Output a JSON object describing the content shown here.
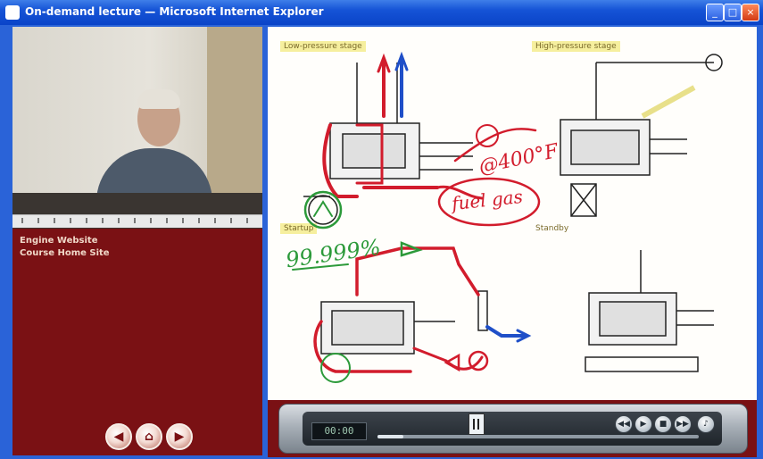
{
  "window": {
    "title": "On-demand lecture — Microsoft Internet Explorer",
    "buttons": {
      "minimize": "_",
      "maximize": "□",
      "close": "×"
    }
  },
  "left_panel": {
    "info_lines": [
      "Engine Website",
      "Course Home Site"
    ],
    "nav_buttons": [
      {
        "icon": "previous-icon",
        "glyph": "◀"
      },
      {
        "icon": "home-icon",
        "glyph": "⌂"
      },
      {
        "icon": "next-icon",
        "glyph": "▶"
      }
    ]
  },
  "slide": {
    "panel_labels": [
      "Low-pressure stage",
      "High-pressure stage",
      "Startup",
      "Standby"
    ],
    "annotations": {
      "temp": "@400°F",
      "fuel_gas": "fuel gas",
      "purity": "99.999%"
    }
  },
  "player": {
    "time": "00:00",
    "progress": 0.08,
    "buttons": [
      {
        "icon": "rewind-icon",
        "glyph": "◀◀"
      },
      {
        "icon": "play-icon",
        "glyph": "▶"
      },
      {
        "icon": "stop-icon",
        "glyph": "■"
      },
      {
        "icon": "fast-forward-icon",
        "glyph": "▶▶"
      },
      {
        "icon": "volume-icon",
        "glyph": "♪"
      }
    ]
  },
  "colors": {
    "title_bar": "#0a44c8",
    "sidebar_bg": "#7a1114",
    "ink_red": "#d21c2c",
    "ink_green": "#2c9a3a",
    "ink_blue": "#1f4fc8"
  }
}
